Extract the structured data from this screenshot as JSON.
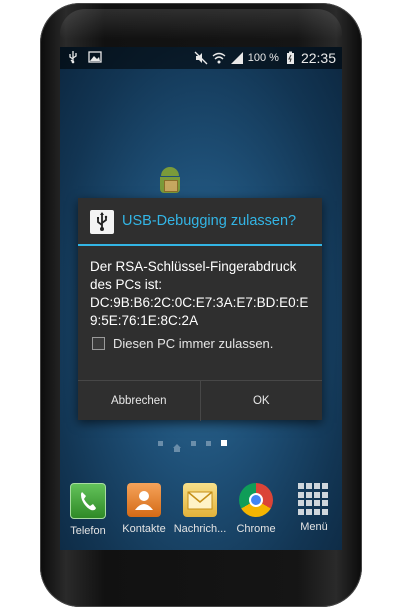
{
  "statusbar": {
    "battery": "100 %",
    "clock": "22:35",
    "icons_left": [
      "usb-icon",
      "image-icon"
    ],
    "icons_right": [
      "mute-icon",
      "wifi-icon",
      "signal-icon",
      "battery-icon"
    ]
  },
  "dialog": {
    "title": "USB-Debugging zulassen?",
    "message_lines": [
      "Der RSA-Schlüssel-Fingerabdruck",
      "des PCs ist:",
      "DC:9B:B6:2C:0C:E7:3A:E7:BD:E0:E",
      "9:5E:76:1E:8C:2A"
    ],
    "checkbox_label": "Diesen PC immer zulassen.",
    "cancel_label": "Abbrechen",
    "ok_label": "OK"
  },
  "dock": {
    "items": [
      {
        "label": "Telefon",
        "icon": "phone-icon"
      },
      {
        "label": "Kontakte",
        "icon": "contacts-icon"
      },
      {
        "label": "Nachrich...",
        "icon": "messages-icon"
      },
      {
        "label": "Chrome",
        "icon": "chrome-icon"
      },
      {
        "label": "Menü",
        "icon": "apps-menu-icon"
      }
    ]
  },
  "colors": {
    "accent": "#33b5e5",
    "dialog_bg": "#2f2f2f"
  }
}
